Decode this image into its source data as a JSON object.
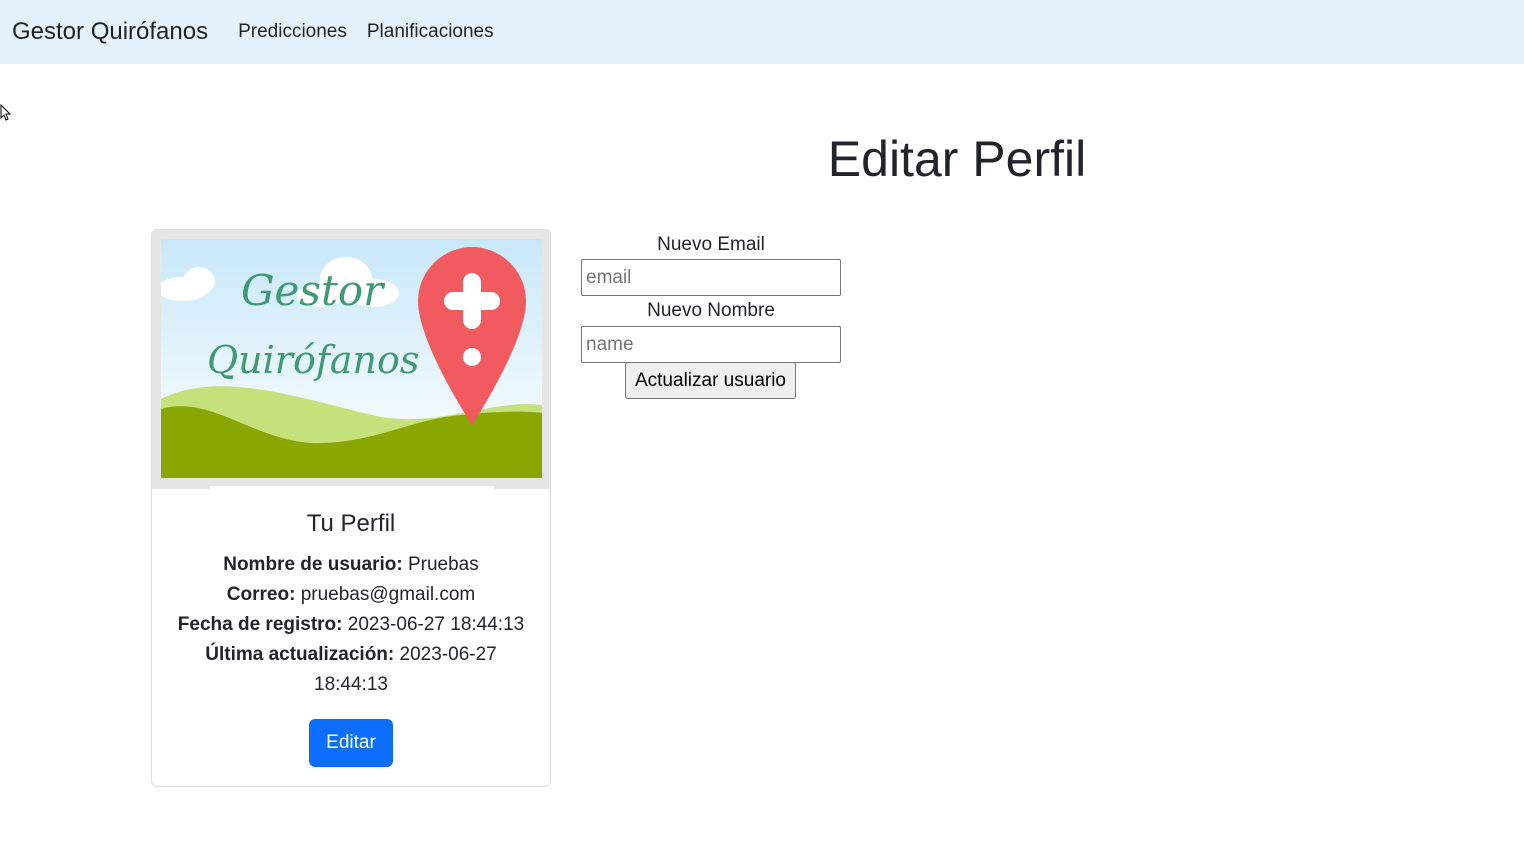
{
  "navbar": {
    "brand": "Gestor Quirófanos",
    "links": [
      "Predicciones",
      "Planificaciones"
    ]
  },
  "page": {
    "title": "Editar Perfil"
  },
  "profile_card": {
    "image": {
      "logo_text_line1": "Gestor",
      "logo_text_line2": "Quirófanos",
      "icon": "map-pin-plus-icon"
    },
    "title": "Tu Perfil",
    "username_label": "Nombre de usuario:",
    "username_value": "Pruebas",
    "email_label": "Correo:",
    "email_value": "pruebas@gmail.com",
    "registered_label": "Fecha de registro:",
    "registered_value": "2023-06-27 18:44:13",
    "updated_label": "Última actualización:",
    "updated_value_line1": "2023-06-27",
    "updated_value_line2": "18:44:13",
    "edit_button": "Editar"
  },
  "form": {
    "email_label": "Nuevo Email",
    "email_placeholder": "email",
    "email_value": "",
    "name_label": "Nuevo Nombre",
    "name_placeholder": "name",
    "name_value": "",
    "submit_button": "Actualizar usuario"
  },
  "colors": {
    "navbar_bg": "#e3f2fd",
    "primary": "#0d6efd",
    "pin": "#f15a5f",
    "hills": "#8aa600",
    "logo_text": "#3f9a74"
  }
}
